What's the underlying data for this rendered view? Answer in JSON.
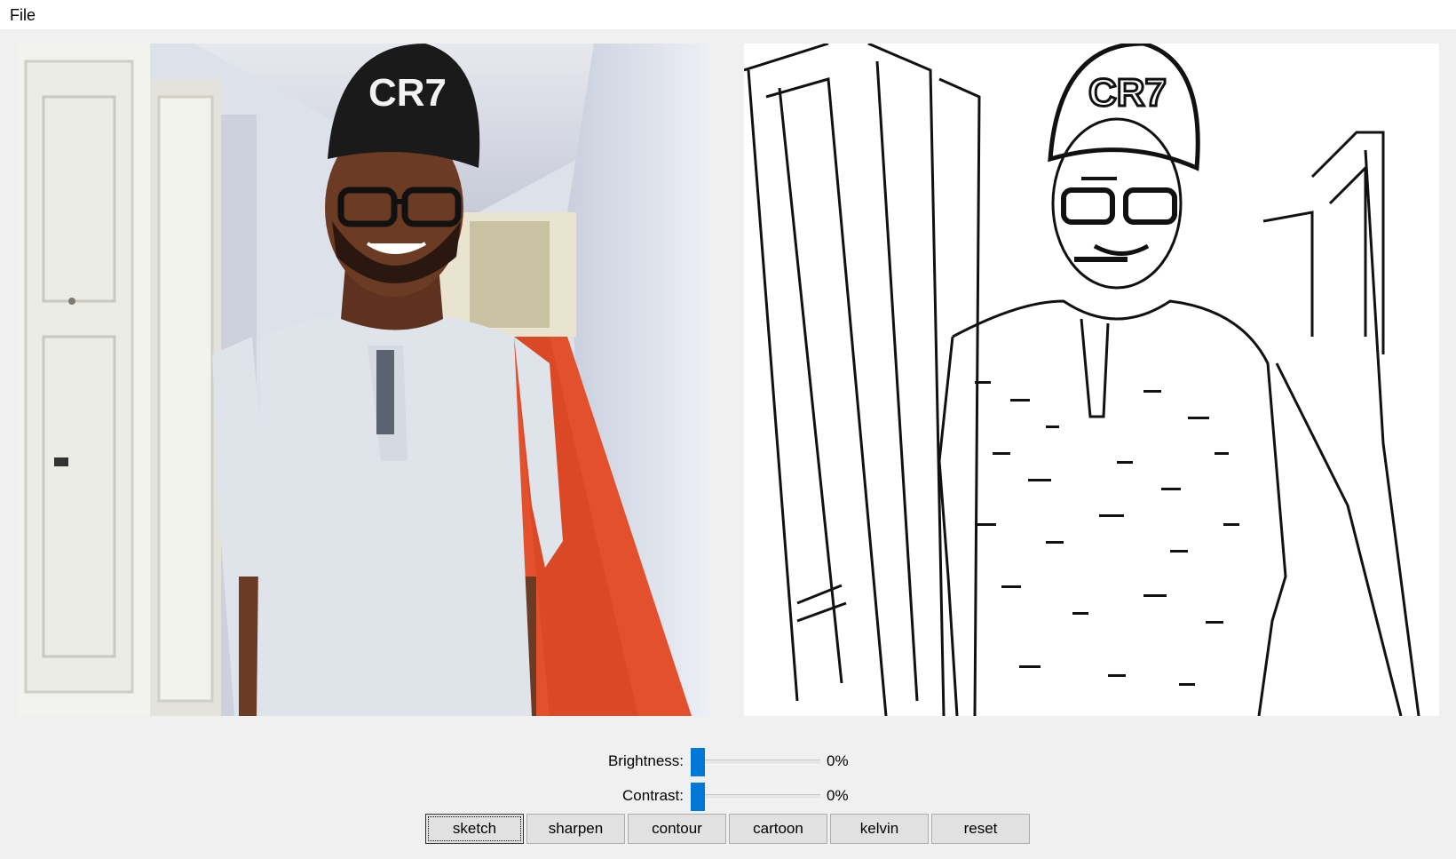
{
  "menubar": {
    "file_label": "File"
  },
  "images": {
    "original": {
      "alt": "Original photo"
    },
    "processed": {
      "alt": "Processed photo"
    }
  },
  "controls": {
    "brightness": {
      "label": "Brightness:",
      "value": "0%",
      "fraction": 0
    },
    "contrast": {
      "label": "Contrast:",
      "value": "0%",
      "fraction": 0
    }
  },
  "buttons": [
    {
      "label": "sketch",
      "focused": true
    },
    {
      "label": "sharpen"
    },
    {
      "label": "contour"
    },
    {
      "label": "cartoon"
    },
    {
      "label": "kelvin"
    },
    {
      "label": "reset"
    }
  ],
  "colors": {
    "slider_thumb": "#0078d7",
    "carpet": "#e2502c",
    "shirt": "#dfe3ea",
    "skin": "#6b3b24"
  }
}
